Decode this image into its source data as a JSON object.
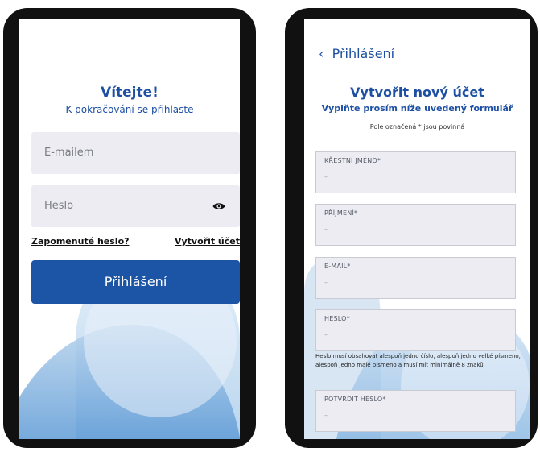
{
  "login": {
    "title": "Vítejte!",
    "subtitle": "K pokračování se přihlaste",
    "email_placeholder": "E-mailem",
    "password_placeholder": "Heslo",
    "forgot_password": "Zapomenuté heslo?",
    "create_account": "Vytvořit účet",
    "login_button": "Přihlášení",
    "accent_color": "#1d55a6",
    "eye_icon": "eye-icon"
  },
  "register": {
    "back_label": "Přihlášení",
    "title": "Vytvořit nový účet",
    "subtitle": "Vyplňte prosím níže uvedený formulář",
    "required_note": "Pole označená * jsou povinná",
    "fields": [
      {
        "label": "KŘESTNÍ JMÉNO*",
        "placeholder": "–"
      },
      {
        "label": "PŘÍJMENÍ*",
        "placeholder": "–"
      },
      {
        "label": "E-MAIL*",
        "placeholder": "–"
      },
      {
        "label": "HESLO*",
        "placeholder": "–"
      },
      {
        "label": "POTVRDIT HESLO*",
        "placeholder": "–"
      }
    ],
    "password_hint": "Heslo musí obsahovat alespoň jedno číslo, alespoň jedno velké písmeno, alespoň jedno malé písmeno a musí mít minimálně 8 znaků"
  }
}
